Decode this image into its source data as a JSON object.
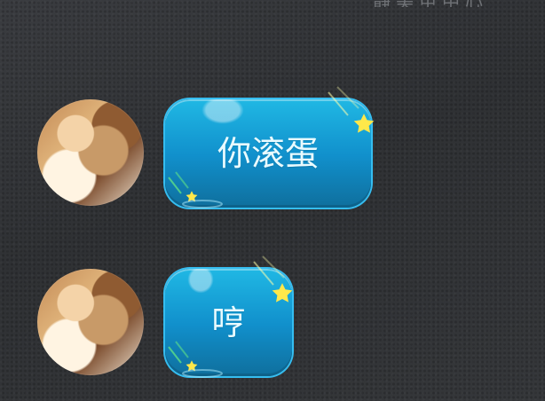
{
  "header": {
    "top_fragment": "静美甲中心"
  },
  "messages": [
    {
      "text": "你滚蛋",
      "avatar": "avatar-girl"
    },
    {
      "text": "哼",
      "avatar": "avatar-girl"
    }
  ],
  "colors": {
    "background": "#333539",
    "bubble_top": "#20b8e4",
    "bubble_bottom": "#0f6f9d",
    "bubble_text": "#e9fbff",
    "star": "#ffe84a"
  }
}
